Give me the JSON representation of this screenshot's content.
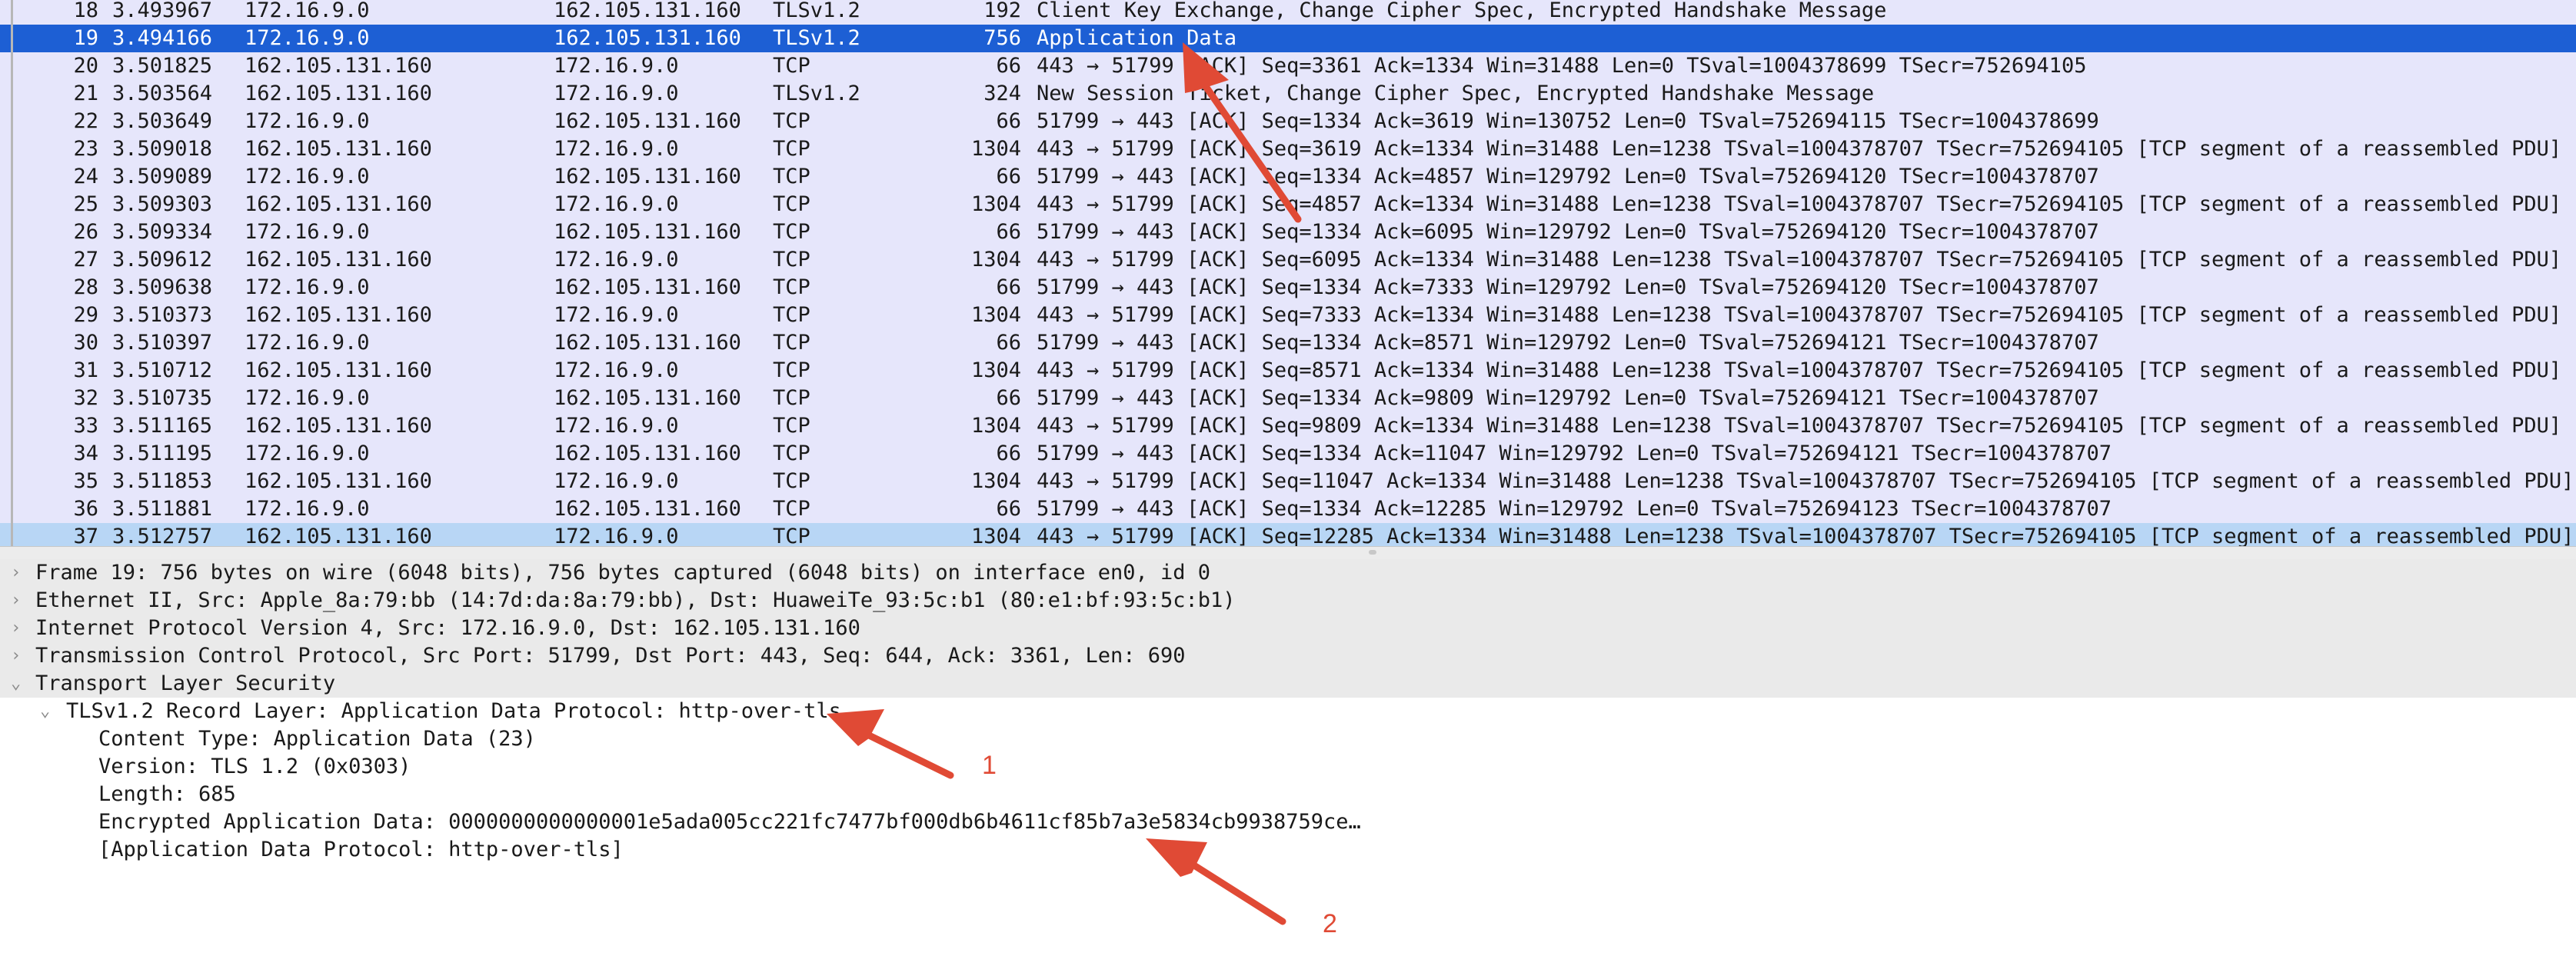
{
  "packet_list": {
    "rows": [
      {
        "no": "18",
        "time": "3.493967",
        "src": "172.16.9.0",
        "dst": "162.105.131.160",
        "proto": "TLSv1.2",
        "len": "192",
        "info": "Client Key Exchange, Change Cipher Spec, Encrypted Handshake Message"
      },
      {
        "no": "19",
        "time": "3.494166",
        "src": "172.16.9.0",
        "dst": "162.105.131.160",
        "proto": "TLSv1.2",
        "len": "756",
        "info": "Application Data"
      },
      {
        "no": "20",
        "time": "3.501825",
        "src": "162.105.131.160",
        "dst": "172.16.9.0",
        "proto": "TCP",
        "len": "66",
        "info": "443 → 51799 [ACK] Seq=3361 Ack=1334 Win=31488 Len=0 TSval=1004378699 TSecr=752694105"
      },
      {
        "no": "21",
        "time": "3.503564",
        "src": "162.105.131.160",
        "dst": "172.16.9.0",
        "proto": "TLSv1.2",
        "len": "324",
        "info": "New Session Ticket, Change Cipher Spec, Encrypted Handshake Message"
      },
      {
        "no": "22",
        "time": "3.503649",
        "src": "172.16.9.0",
        "dst": "162.105.131.160",
        "proto": "TCP",
        "len": "66",
        "info": "51799 → 443 [ACK] Seq=1334 Ack=3619 Win=130752 Len=0 TSval=752694115 TSecr=1004378699"
      },
      {
        "no": "23",
        "time": "3.509018",
        "src": "162.105.131.160",
        "dst": "172.16.9.0",
        "proto": "TCP",
        "len": "1304",
        "info": "443 → 51799 [ACK] Seq=3619 Ack=1334 Win=31488 Len=1238 TSval=1004378707 TSecr=752694105 [TCP segment of a reassembled PDU]"
      },
      {
        "no": "24",
        "time": "3.509089",
        "src": "172.16.9.0",
        "dst": "162.105.131.160",
        "proto": "TCP",
        "len": "66",
        "info": "51799 → 443 [ACK] Seq=1334 Ack=4857 Win=129792 Len=0 TSval=752694120 TSecr=1004378707"
      },
      {
        "no": "25",
        "time": "3.509303",
        "src": "162.105.131.160",
        "dst": "172.16.9.0",
        "proto": "TCP",
        "len": "1304",
        "info": "443 → 51799 [ACK] Seq=4857 Ack=1334 Win=31488 Len=1238 TSval=1004378707 TSecr=752694105 [TCP segment of a reassembled PDU]"
      },
      {
        "no": "26",
        "time": "3.509334",
        "src": "172.16.9.0",
        "dst": "162.105.131.160",
        "proto": "TCP",
        "len": "66",
        "info": "51799 → 443 [ACK] Seq=1334 Ack=6095 Win=129792 Len=0 TSval=752694120 TSecr=1004378707"
      },
      {
        "no": "27",
        "time": "3.509612",
        "src": "162.105.131.160",
        "dst": "172.16.9.0",
        "proto": "TCP",
        "len": "1304",
        "info": "443 → 51799 [ACK] Seq=6095 Ack=1334 Win=31488 Len=1238 TSval=1004378707 TSecr=752694105 [TCP segment of a reassembled PDU]"
      },
      {
        "no": "28",
        "time": "3.509638",
        "src": "172.16.9.0",
        "dst": "162.105.131.160",
        "proto": "TCP",
        "len": "66",
        "info": "51799 → 443 [ACK] Seq=1334 Ack=7333 Win=129792 Len=0 TSval=752694120 TSecr=1004378707"
      },
      {
        "no": "29",
        "time": "3.510373",
        "src": "162.105.131.160",
        "dst": "172.16.9.0",
        "proto": "TCP",
        "len": "1304",
        "info": "443 → 51799 [ACK] Seq=7333 Ack=1334 Win=31488 Len=1238 TSval=1004378707 TSecr=752694105 [TCP segment of a reassembled PDU]"
      },
      {
        "no": "30",
        "time": "3.510397",
        "src": "172.16.9.0",
        "dst": "162.105.131.160",
        "proto": "TCP",
        "len": "66",
        "info": "51799 → 443 [ACK] Seq=1334 Ack=8571 Win=129792 Len=0 TSval=752694121 TSecr=1004378707"
      },
      {
        "no": "31",
        "time": "3.510712",
        "src": "162.105.131.160",
        "dst": "172.16.9.0",
        "proto": "TCP",
        "len": "1304",
        "info": "443 → 51799 [ACK] Seq=8571 Ack=1334 Win=31488 Len=1238 TSval=1004378707 TSecr=752694105 [TCP segment of a reassembled PDU]"
      },
      {
        "no": "32",
        "time": "3.510735",
        "src": "172.16.9.0",
        "dst": "162.105.131.160",
        "proto": "TCP",
        "len": "66",
        "info": "51799 → 443 [ACK] Seq=1334 Ack=9809 Win=129792 Len=0 TSval=752694121 TSecr=1004378707"
      },
      {
        "no": "33",
        "time": "3.511165",
        "src": "162.105.131.160",
        "dst": "172.16.9.0",
        "proto": "TCP",
        "len": "1304",
        "info": "443 → 51799 [ACK] Seq=9809 Ack=1334 Win=31488 Len=1238 TSval=1004378707 TSecr=752694105 [TCP segment of a reassembled PDU]"
      },
      {
        "no": "34",
        "time": "3.511195",
        "src": "172.16.9.0",
        "dst": "162.105.131.160",
        "proto": "TCP",
        "len": "66",
        "info": "51799 → 443 [ACK] Seq=1334 Ack=11047 Win=129792 Len=0 TSval=752694121 TSecr=1004378707"
      },
      {
        "no": "35",
        "time": "3.511853",
        "src": "162.105.131.160",
        "dst": "172.16.9.0",
        "proto": "TCP",
        "len": "1304",
        "info": "443 → 51799 [ACK] Seq=11047 Ack=1334 Win=31488 Len=1238 TSval=1004378707 TSecr=752694105 [TCP segment of a reassembled PDU]"
      },
      {
        "no": "36",
        "time": "3.511881",
        "src": "172.16.9.0",
        "dst": "162.105.131.160",
        "proto": "TCP",
        "len": "66",
        "info": "51799 → 443 [ACK] Seq=1334 Ack=12285 Win=129792 Len=0 TSval=752694123 TSecr=1004378707"
      },
      {
        "no": "37",
        "time": "3.512757",
        "src": "162.105.131.160",
        "dst": "172.16.9.0",
        "proto": "TCP",
        "len": "1304",
        "info": "443 → 51799 [ACK] Seq=12285 Ack=1334 Win=31488 Len=1238 TSval=1004378707 TSecr=752694105 [TCP segment of a reassembled PDU]"
      }
    ]
  },
  "details": {
    "rows": [
      {
        "text": "Frame 19: 756 bytes on wire (6048 bits), 756 bytes captured (6048 bits) on interface en0, id 0",
        "expander": "collapsed-arrow-icon",
        "expander_glyph": "›"
      },
      {
        "text": "Ethernet II, Src: Apple_8a:79:bb (14:7d:da:8a:79:bb), Dst: HuaweiTe_93:5c:b1 (80:e1:bf:93:5c:b1)",
        "expander": "collapsed-arrow-icon",
        "expander_glyph": "›"
      },
      {
        "text": "Internet Protocol Version 4, Src: 172.16.9.0, Dst: 162.105.131.160",
        "expander": "collapsed-arrow-icon",
        "expander_glyph": "›"
      },
      {
        "text": "Transmission Control Protocol, Src Port: 51799, Dst Port: 443, Seq: 644, Ack: 3361, Len: 690",
        "expander": "collapsed-arrow-icon",
        "expander_glyph": "›"
      },
      {
        "text": "Transport Layer Security",
        "expander": "expanded-arrow-icon",
        "expander_glyph": "⌄"
      },
      {
        "text": "TLSv1.2 Record Layer: Application Data Protocol: http-over-tls",
        "expander": "expanded-arrow-icon",
        "expander_glyph": "⌄"
      },
      {
        "text": "Content Type: Application Data (23)",
        "expander": "",
        "expander_glyph": ""
      },
      {
        "text": "Version: TLS 1.2 (0x0303)",
        "expander": "",
        "expander_glyph": ""
      },
      {
        "text": "Length: 685",
        "expander": "",
        "expander_glyph": ""
      },
      {
        "text": "Encrypted Application Data: 0000000000000001e5ada005cc221fc7477bf000db6b4611cf85b7a3e5834cb9938759ce…",
        "expander": "",
        "expander_glyph": ""
      },
      {
        "text": "[Application Data Protocol: http-over-tls]",
        "expander": "",
        "expander_glyph": ""
      }
    ]
  },
  "annotations": {
    "label_1": "1",
    "label_2": "2",
    "color": "#e04a35"
  },
  "colors": {
    "selected_row": "#1d5fd4",
    "tcp_row": "#e6e6fb",
    "highlight_row": "#b8d6f5"
  }
}
